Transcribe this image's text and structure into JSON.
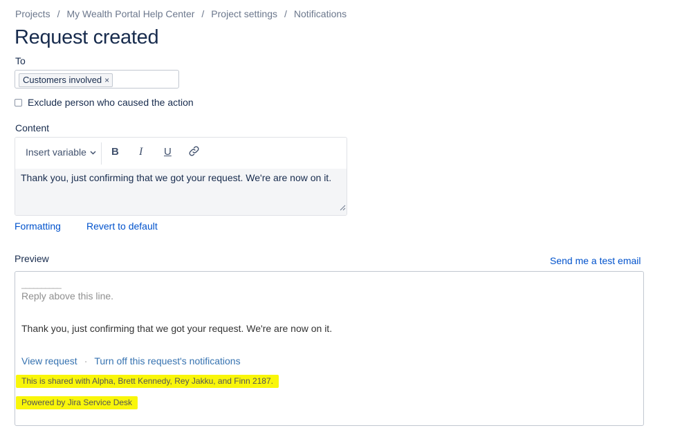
{
  "breadcrumb": {
    "items": [
      "Projects",
      "My Wealth Portal Help Center",
      "Project settings",
      "Notifications"
    ],
    "separator": "/"
  },
  "page": {
    "title": "Request created"
  },
  "to_field": {
    "label": "To",
    "chip": "Customers involved",
    "chip_remove": "×"
  },
  "exclude_checkbox": {
    "label": "Exclude person who caused the action",
    "checked": false
  },
  "content": {
    "label": "Content",
    "toolbar": {
      "insert_variable": "Insert variable",
      "bold": "B",
      "italic": "I",
      "underline": "U",
      "link_icon": "link-icon"
    },
    "body": "Thank you, just confirming that we got your request. We're are now on it."
  },
  "links": {
    "formatting": "Formatting",
    "revert": "Revert to default"
  },
  "preview": {
    "label": "Preview",
    "send_test": "Send me a test email",
    "divider_line": "__________",
    "reply_above": "Reply above this line.",
    "body": "Thank you, just confirming that we got your request. We're are now on it.",
    "view_request": "View request",
    "dot": "·",
    "turn_off": "Turn off this request's notifications",
    "shared_with": "This is shared with Alpha, Brett Kennedy, Rey Jakku, and Finn 2187.",
    "powered_by": "Powered by Jira Service Desk"
  },
  "colors": {
    "link": "#0052cc",
    "highlight": "#f9f60a",
    "text": "#172b4d"
  }
}
